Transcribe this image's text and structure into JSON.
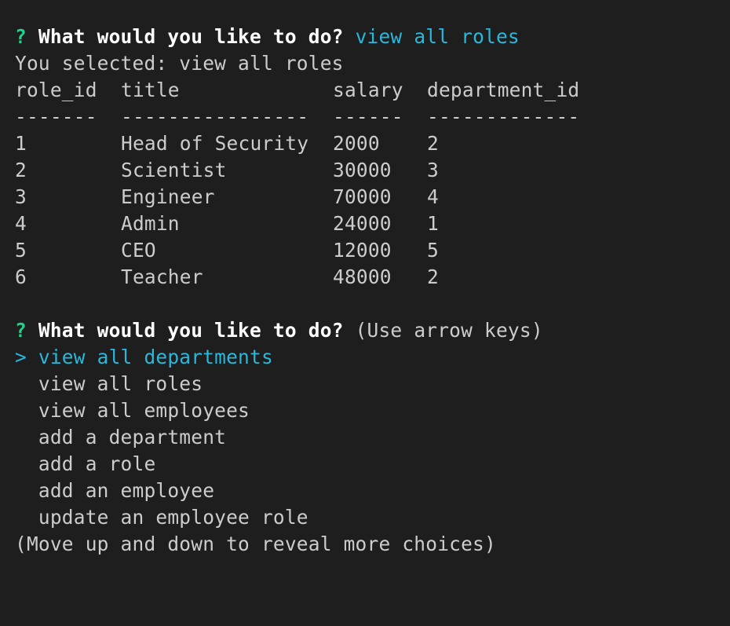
{
  "colors": {
    "background": "#1e1e1e",
    "text": "#cccccc",
    "prompt_mark": "#23d18b",
    "highlight": "#29b8db",
    "bold_text": "#ffffff"
  },
  "first_prompt": {
    "mark": "?",
    "question": "What would you like to do?",
    "answer": "view all roles"
  },
  "selection_echo": "You selected: view all roles",
  "roles_table": {
    "headers": [
      "role_id",
      "title",
      "salary",
      "department_id"
    ],
    "separators": [
      "-------",
      "----------------",
      "------",
      "-------------"
    ],
    "rows": [
      [
        "1",
        "Head of Security",
        "2000",
        "2"
      ],
      [
        "2",
        "Scientist",
        "30000",
        "3"
      ],
      [
        "3",
        "Engineer",
        "70000",
        "4"
      ],
      [
        "4",
        "Admin",
        "24000",
        "1"
      ],
      [
        "5",
        "CEO",
        "12000",
        "5"
      ],
      [
        "6",
        "Teacher",
        "48000",
        "2"
      ]
    ]
  },
  "second_prompt": {
    "mark": "?",
    "question": "What would you like to do?",
    "hint": "(Use arrow keys)",
    "pointer": ">",
    "choices": [
      "view all departments",
      "view all roles",
      "view all employees",
      "add a department",
      "add a role",
      "add an employee",
      "update an employee role"
    ],
    "selected_index": 0,
    "more_hint": "(Move up and down to reveal more choices)"
  }
}
